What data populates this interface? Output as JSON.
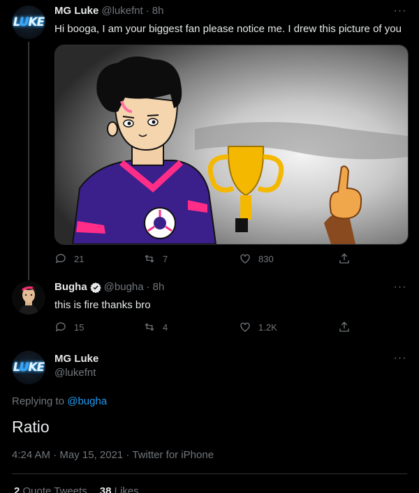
{
  "tweet1": {
    "name": "MG Luke",
    "handle": "@lukefnt",
    "dot": "·",
    "time": "8h",
    "text": "Hi booga, I am your biggest fan please notice me. I drew this picture of you",
    "more": "···",
    "avatar_logo": "LUKE",
    "actions": {
      "reply": "21",
      "retweet": "7",
      "like": "830"
    }
  },
  "tweet2": {
    "name": "Bugha",
    "handle": "@bugha",
    "dot": "·",
    "time": "8h",
    "text": "this is fire thanks bro",
    "more": "···",
    "actions": {
      "reply": "15",
      "retweet": "4",
      "like": "1.2K"
    }
  },
  "main": {
    "name": "MG Luke",
    "handle": "@lukefnt",
    "more": "···",
    "avatar_logo": "LUKE",
    "replying_prefix": "Replying to ",
    "replying_mention": "@bugha",
    "text": "Ratio",
    "meta": "4:24 AM · May 15, 2021 · Twitter for iPhone",
    "stats": {
      "quote_count": "2",
      "quote_label": "Quote Tweets",
      "like_count": "38",
      "like_label": "Likes"
    }
  },
  "icons": {
    "reply": "reply-icon",
    "retweet": "retweet-icon",
    "like": "heart-icon",
    "share": "share-icon",
    "verified": "verified-badge-icon",
    "more": "more-options-icon"
  },
  "colors": {
    "background": "#000000",
    "text": "#e7e9ea",
    "secondary": "#71767b",
    "divider": "#2f3336",
    "accent": "#1d9bf0",
    "verified": "#e7e9ea"
  }
}
